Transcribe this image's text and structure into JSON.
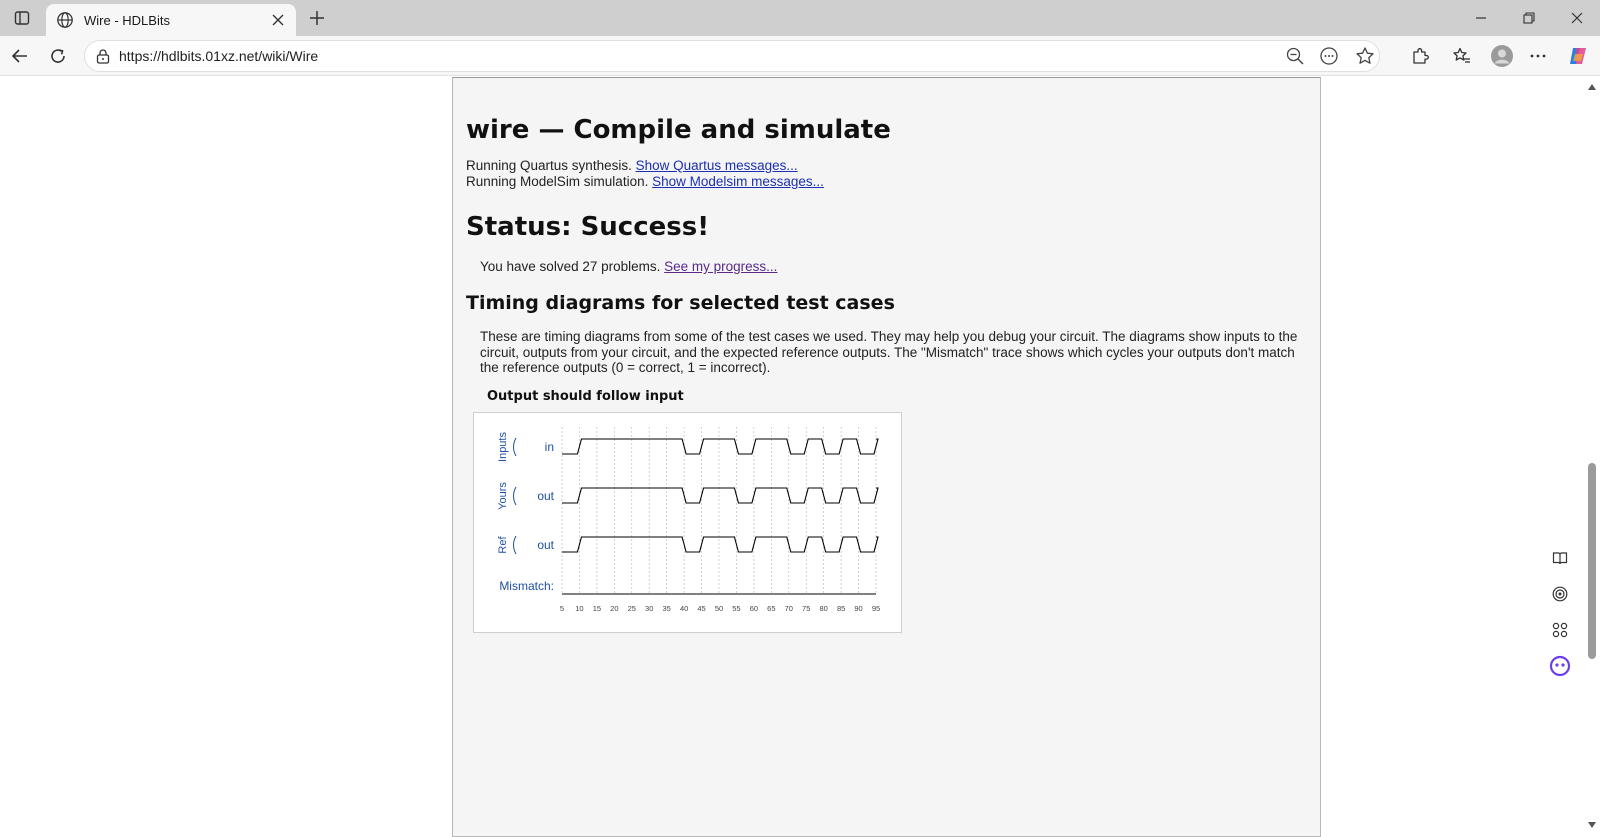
{
  "browser": {
    "tab_title": "Wire - HDLBits",
    "url": "https://hdlbits.01xz.net/wiki/Wire"
  },
  "page": {
    "heading": "wire — Compile and simulate",
    "quartus_text": "Running Quartus synthesis.",
    "quartus_link": "Show Quartus messages...",
    "modelsim_text": "Running ModelSim simulation.",
    "modelsim_link": "Show Modelsim messages...",
    "status": "Status: Success!",
    "solved_text": "You have solved 27 problems.",
    "progress_link": "See my progress...",
    "timing_heading": "Timing diagrams for selected test cases",
    "timing_desc": "These are timing diagrams from some of the test cases we used. They may help you debug your circuit. The diagrams show inputs to the circuit, outputs from your circuit, and the expected reference outputs. The \"Mismatch\" trace shows which cycles your outputs don't match the reference outputs (0 = correct, 1 = incorrect).",
    "case_title": "Output should follow input"
  },
  "timing": {
    "groups": [
      "Inputs",
      "Yours",
      "Ref"
    ],
    "signals": [
      "in",
      "out",
      "out"
    ],
    "mismatch_label": "Mismatch:",
    "ticks": [
      "5",
      "10",
      "15",
      "20",
      "25",
      "30",
      "35",
      "40",
      "45",
      "50",
      "55",
      "60",
      "65",
      "70",
      "75",
      "80",
      "85",
      "90",
      "95"
    ],
    "wave_in": [
      0,
      1,
      1,
      1,
      1,
      1,
      1,
      0,
      1,
      1,
      0,
      1,
      1,
      0,
      1,
      0,
      1,
      0,
      1
    ],
    "wave_out": [
      0,
      1,
      1,
      1,
      1,
      1,
      1,
      0,
      1,
      1,
      0,
      1,
      1,
      0,
      1,
      0,
      1,
      0,
      1
    ],
    "wave_ref": [
      0,
      1,
      1,
      1,
      1,
      1,
      1,
      0,
      1,
      1,
      0,
      1,
      1,
      0,
      1,
      0,
      1,
      0,
      1
    ],
    "wave_mismatch": [
      0,
      0,
      0,
      0,
      0,
      0,
      0,
      0,
      0,
      0,
      0,
      0,
      0,
      0,
      0,
      0,
      0,
      0,
      0
    ],
    "colors": {
      "label": "#1f4fa3",
      "wave": "#000000",
      "grid": "#b5b5b5"
    }
  }
}
